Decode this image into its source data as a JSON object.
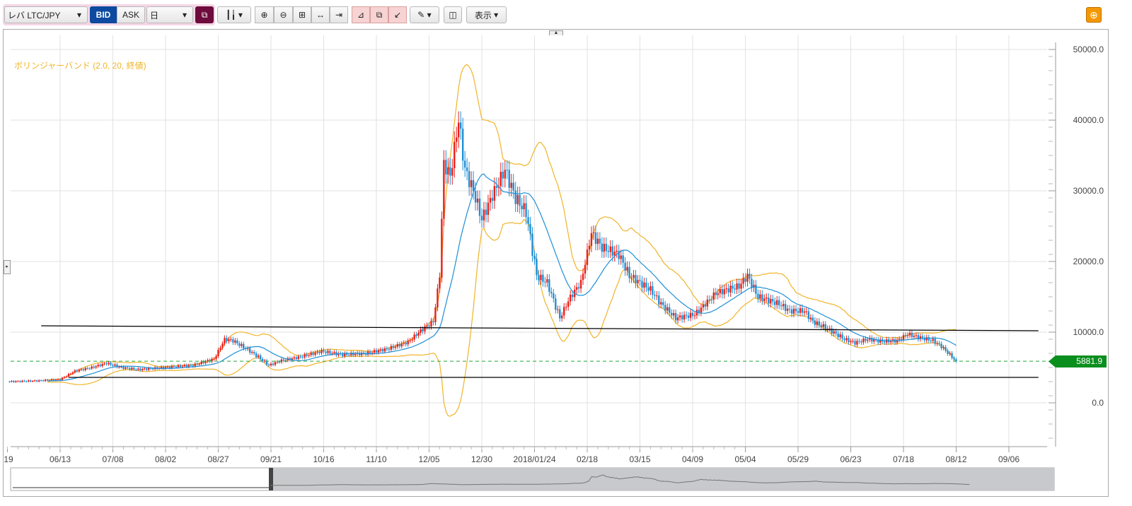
{
  "toolbar": {
    "symbol": "レバ LTC/JPY",
    "bid": "BID",
    "ask": "ASK",
    "timeframe": "日",
    "display": "表示",
    "icons": [
      "link-icon",
      "chart-type-icon",
      "zoom-in-icon",
      "zoom-out-icon",
      "fit-icon",
      "expand-width-icon",
      "scroll-end-icon",
      "add-indicator-icon",
      "copy-indicator-icon",
      "remove-indicator-icon",
      "draw-pen-icon",
      "chart-settings-icon",
      "fullscreen-icon"
    ],
    "colors": {
      "bid": "#0d4aa0",
      "link": "#6e0a3c",
      "accent": "#f39800"
    }
  },
  "indicator": {
    "label": "ボリンジャーバンド (2.0, 20, 終値)",
    "color": "#f0b429",
    "middle_color": "#1f8fd6"
  },
  "price_tag": "5881.9",
  "chart_data": {
    "type": "candlestick",
    "y_ticks": [
      "50000.0",
      "40000.0",
      "30000.0",
      "20000.0",
      "10000.0",
      "0.0"
    ],
    "ylim": [
      -6000,
      52000
    ],
    "x_ticks": [
      "19",
      "06/13",
      "07/08",
      "08/02",
      "08/27",
      "09/21",
      "10/16",
      "11/10",
      "12/05",
      "12/30",
      "2018/01/24",
      "02/18",
      "03/15",
      "04/09",
      "05/04",
      "05/29",
      "06/23",
      "07/18",
      "08/12",
      "09/06"
    ],
    "x_tick_dates": [
      "2017-05-19",
      "2017-06-13",
      "2017-07-08",
      "2017-08-02",
      "2017-08-27",
      "2017-09-21",
      "2017-10-16",
      "2017-11-10",
      "2017-12-05",
      "2017-12-30",
      "2018-01-24",
      "2018-02-18",
      "2018-03-15",
      "2018-04-09",
      "2018-05-04",
      "2018-05-29",
      "2018-06-23",
      "2018-07-18",
      "2018-08-12",
      "2018-09-06"
    ],
    "close_keypoints": [
      [
        "2017-05-19",
        3000
      ],
      [
        "2017-06-01",
        3100
      ],
      [
        "2017-06-13",
        3300
      ],
      [
        "2017-06-20",
        4500
      ],
      [
        "2017-06-28",
        5000
      ],
      [
        "2017-07-05",
        5600
      ],
      [
        "2017-07-12",
        5000
      ],
      [
        "2017-07-20",
        4700
      ],
      [
        "2017-08-01",
        5000
      ],
      [
        "2017-08-15",
        5300
      ],
      [
        "2017-08-25",
        6200
      ],
      [
        "2017-08-30",
        9000
      ],
      [
        "2017-09-03",
        8800
      ],
      [
        "2017-09-10",
        7500
      ],
      [
        "2017-09-15",
        6500
      ],
      [
        "2017-09-20",
        5300
      ],
      [
        "2017-09-25",
        5900
      ],
      [
        "2017-10-05",
        6500
      ],
      [
        "2017-10-15",
        7300
      ],
      [
        "2017-10-25",
        6800
      ],
      [
        "2017-11-05",
        7000
      ],
      [
        "2017-11-15",
        7600
      ],
      [
        "2017-11-25",
        8600
      ],
      [
        "2017-12-01",
        10200
      ],
      [
        "2017-12-07",
        11500
      ],
      [
        "2017-12-10",
        18000
      ],
      [
        "2017-12-12",
        34000
      ],
      [
        "2017-12-15",
        32000
      ],
      [
        "2017-12-19",
        40000
      ],
      [
        "2017-12-22",
        33000
      ],
      [
        "2017-12-26",
        30000
      ],
      [
        "2017-12-30",
        26000
      ],
      [
        "2018-01-05",
        30000
      ],
      [
        "2018-01-10",
        33000
      ],
      [
        "2018-01-15",
        29000
      ],
      [
        "2018-01-20",
        27000
      ],
      [
        "2018-01-25",
        18000
      ],
      [
        "2018-01-30",
        17000
      ],
      [
        "2018-02-05",
        12000
      ],
      [
        "2018-02-10",
        15000
      ],
      [
        "2018-02-15",
        17000
      ],
      [
        "2018-02-20",
        24000
      ],
      [
        "2018-02-25",
        22000
      ],
      [
        "2018-03-01",
        21500
      ],
      [
        "2018-03-05",
        21000
      ],
      [
        "2018-03-10",
        18000
      ],
      [
        "2018-03-15",
        17000
      ],
      [
        "2018-03-20",
        16000
      ],
      [
        "2018-03-25",
        14000
      ],
      [
        "2018-04-01",
        12000
      ],
      [
        "2018-04-10",
        12500
      ],
      [
        "2018-04-15",
        14000
      ],
      [
        "2018-04-20",
        15500
      ],
      [
        "2018-04-25",
        16000
      ],
      [
        "2018-05-01",
        16500
      ],
      [
        "2018-05-05",
        18000
      ],
      [
        "2018-05-10",
        15000
      ],
      [
        "2018-05-15",
        14500
      ],
      [
        "2018-05-20",
        14000
      ],
      [
        "2018-05-25",
        13000
      ],
      [
        "2018-06-01",
        13000
      ],
      [
        "2018-06-05",
        11500
      ],
      [
        "2018-06-12",
        10500
      ],
      [
        "2018-06-20",
        9000
      ],
      [
        "2018-06-25",
        8500
      ],
      [
        "2018-07-01",
        9000
      ],
      [
        "2018-07-08",
        8700
      ],
      [
        "2018-07-15",
        8800
      ],
      [
        "2018-07-20",
        9700
      ],
      [
        "2018-07-25",
        9300
      ],
      [
        "2018-08-01",
        8800
      ],
      [
        "2018-08-05",
        8000
      ],
      [
        "2018-08-10",
        6500
      ],
      [
        "2018-08-12",
        5882
      ]
    ],
    "bollinger": {
      "sigma": 2.0,
      "period": 20,
      "source": "終値"
    },
    "lines": [
      {
        "name": "resistance",
        "from": [
          "2017-06-04",
          10900
        ],
        "to": [
          "2018-09-20",
          10200
        ],
        "color": "#000000"
      },
      {
        "name": "support",
        "from": [
          "2017-06-17",
          3600
        ],
        "to": [
          "2018-09-20",
          3600
        ],
        "color": "#000000"
      },
      {
        "name": "current-price",
        "value": 5881.9,
        "color": "#22a83a",
        "style": "dashed"
      }
    ],
    "up_color": "#e8201a",
    "down_color": "#1f8fd6",
    "grid": true
  }
}
